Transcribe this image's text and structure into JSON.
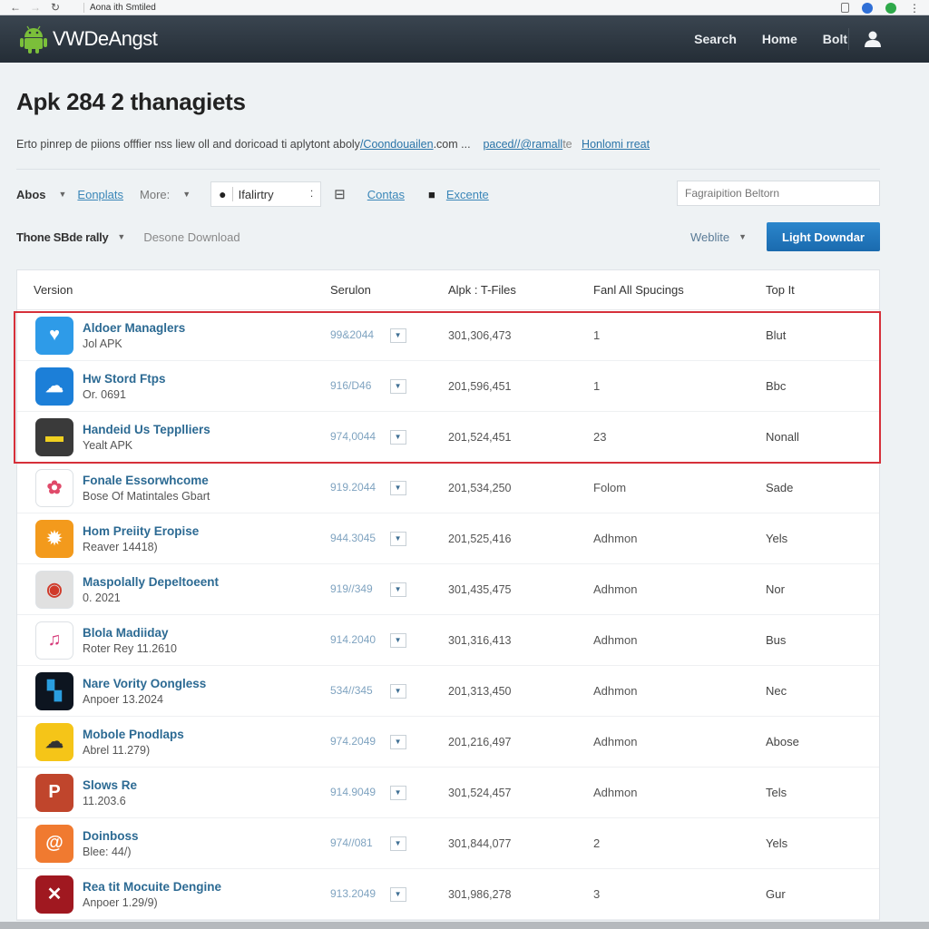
{
  "browser": {
    "back_label": "←",
    "forward_label": "→",
    "reload_label": "↻",
    "tab_title": "Aona ith Smtiled",
    "menu_label": "⋮"
  },
  "header": {
    "brand": "VWDeAngst",
    "nav": [
      "Search",
      "Home",
      "Bolt"
    ],
    "brand_color": "#7bbf3a"
  },
  "page": {
    "title": "Apk 284 2 thanagiets",
    "description": "Erto pinrep de piions offfier nss liew oll and doricoad ti aplytont aboly",
    "links": [
      "/Coondouailen",
      "paced//@ramall",
      "Honlomi rreat"
    ],
    "link_suffix_1": ".com ...",
    "link_suffix_2": "te"
  },
  "toolbar": {
    "abos_label": "Abos",
    "templates_link": "Eonplats",
    "more_label": "More:",
    "select_value": "Ifalirtry",
    "contas_link": "Contas",
    "excente_link": "Excente",
    "search_placeholder": "Fagraipition Beltorn",
    "filter_label": "Thone SBde rally",
    "download_hint": "Desone Download",
    "weblite_label": "Weblite",
    "primary_button": "Light Downdar"
  },
  "table": {
    "columns": [
      "Version",
      "Serulon",
      "Alpk : T-Files",
      "Fanl All Spucings",
      "Top It"
    ],
    "highlighted_rows": [
      0,
      1,
      2
    ],
    "rows": [
      {
        "name": "Aldoer Managlers",
        "sub": "Jol APK",
        "version": "99&2044",
        "size": "301,306,473",
        "spacings": "1",
        "top": "Blut",
        "icon": "chat-bubble-icon",
        "color": "#2e9be8"
      },
      {
        "name": "Hw Stord Ftps",
        "sub": "Or. 0691",
        "version": "916/D46",
        "size": "201,596,451",
        "spacings": "1",
        "top": "Bbc",
        "icon": "cloud-chat-icon",
        "color": "#1c7fd8"
      },
      {
        "name": "Handeid Us Tepplliers",
        "sub": "Yealt APK",
        "version": "974,0044",
        "size": "201,524,451",
        "spacings": "23",
        "top": "Nonall",
        "icon": "device-icon",
        "color": "#3a3a3a"
      },
      {
        "name": "Fonale Essorwhcome",
        "sub": "Bose Of Matintales Gbart",
        "version": "919.2044",
        "size": "201,534,250",
        "spacings": "Folom",
        "top": "Sade",
        "icon": "petal-icon",
        "color": "#ffffff"
      },
      {
        "name": "Hom Preiity Eropise",
        "sub": "Reaver 14418)",
        "version": "944.3045",
        "size": "201,525,416",
        "spacings": "Adhmon",
        "top": "Yels",
        "icon": "badge-icon",
        "color": "#f39a1c"
      },
      {
        "name": "Maspolally Depeltoeent",
        "sub": "0. 2021",
        "version": "919//349",
        "size": "301,435,475",
        "spacings": "Adhmon",
        "top": "Nor",
        "icon": "target-icon",
        "color": "#e0e0e0"
      },
      {
        "name": "Blola Madiiday",
        "sub": "Roter Rey 11.2610",
        "version": "914.2040",
        "size": "301,316,413",
        "spacings": "Adhmon",
        "top": "Bus",
        "icon": "music-note-icon",
        "color": "#ffffff"
      },
      {
        "name": "Nare Vority Oongless",
        "sub": "Anpoer 13.2024",
        "version": "534//345",
        "size": "201,313,450",
        "spacings": "Adhmon",
        "top": "Nec",
        "icon": "blocks-icon",
        "color": "#0d1520"
      },
      {
        "name": "Mobole Pnodlaps",
        "sub": "Abrel 11.279)",
        "version": "974.2049",
        "size": "201,216,497",
        "spacings": "Adhmon",
        "top": "Abose",
        "icon": "cloud-icon",
        "color": "#f5c518"
      },
      {
        "name": "Slows Re",
        "sub": "11.203.6",
        "version": "914.9049",
        "size": "301,524,457",
        "spacings": "Adhmon",
        "top": "Tels",
        "icon": "pinterest-icon",
        "color": "#c0452c"
      },
      {
        "name": "Doinboss",
        "sub": "Blee: 44/)",
        "version": "974//081",
        "size": "301,844,077",
        "spacings": "2",
        "top": "Yels",
        "icon": "swirl-icon",
        "color": "#f07a30"
      },
      {
        "name": "Rea tit Mocuite Dengine",
        "sub": "Anpoer 1.29/9)",
        "version": "913.2049",
        "size": "301,986,278",
        "spacings": "3",
        "top": "Gur",
        "icon": "cross-tools-icon",
        "color": "#a01820"
      }
    ]
  }
}
